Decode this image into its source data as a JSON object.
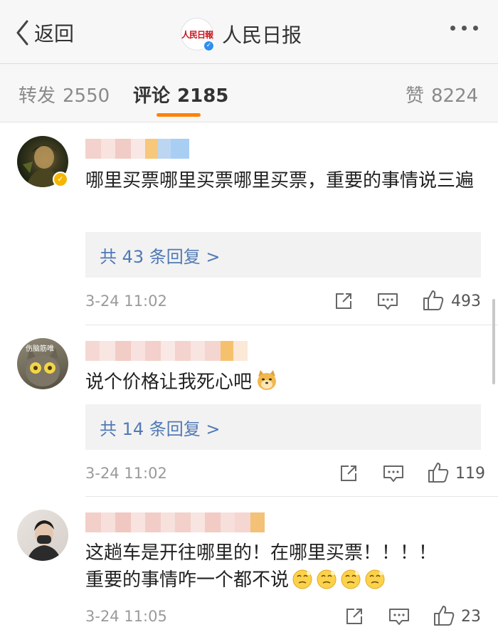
{
  "nav": {
    "back_label": "返回",
    "title": "人民日报",
    "logo_text": "人民日報",
    "logo_caption": "PEOPLE'S DAILY"
  },
  "tabs": [
    {
      "label": "转发",
      "count": "2550",
      "active": false
    },
    {
      "label": "评论",
      "count": "2185",
      "active": true
    },
    {
      "label": "赞",
      "count": "8224",
      "active": false
    }
  ],
  "colors": {
    "accent": "#ff8200",
    "link": "#5079b5",
    "verified_gold": "#f7b500",
    "verified_blue": "#2f8ff0"
  },
  "comments": [
    {
      "text": "哪里买票哪里买票哪里买票，重要的事情说三遍",
      "replies": "共 43 条回复 >",
      "time": "3-24 11:02",
      "likes": "493",
      "verified": true
    },
    {
      "text": "说个价格让我死心吧",
      "emoji": "doge-icon",
      "avatar_text": "伤脑筋唯",
      "replies": "共 14 条回复 >",
      "time": "3-24 11:02",
      "likes": "119",
      "verified": false
    },
    {
      "text_line1": "这趟车是开往哪里的！在哪里买票！！！！",
      "text_line2": "重要的事情咋一个都不说",
      "emoji": "thinking-face-icon",
      "emoji_count": 4,
      "time": "3-24 11:05",
      "likes": "23",
      "verified": false
    }
  ]
}
